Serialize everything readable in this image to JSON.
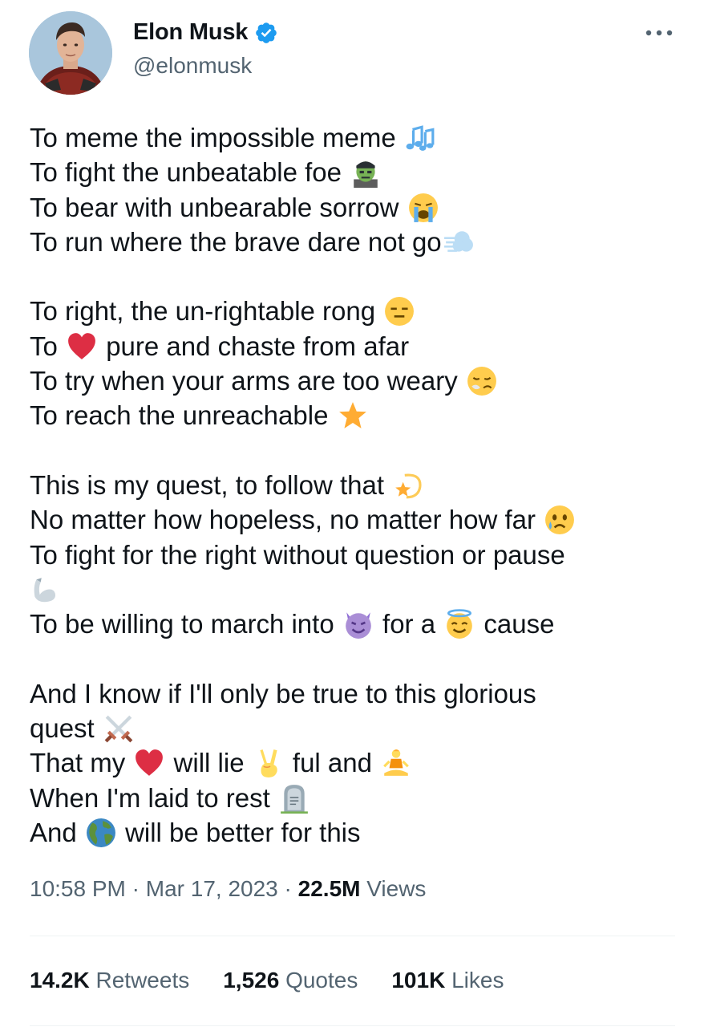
{
  "author": {
    "name": "Elon Musk",
    "handle": "@elonmusk",
    "verified_color": "#1d9bf0"
  },
  "tweet": {
    "lines": [
      {
        "text": "To meme the impossible meme",
        "emoji": "musical-notes-icon"
      },
      {
        "text": "To fight the unbeatable foe",
        "emoji": "zombie-icon"
      },
      {
        "text": "To bear with unbearable sorrow",
        "emoji": "crying-face-icon"
      },
      {
        "text": "To run where the brave dare not go",
        "emoji": "dash-icon"
      },
      {
        "text": "To right, the un-rightable rong",
        "emoji": "expressionless-face-icon"
      },
      {
        "text_before": "To",
        "emoji": "red-heart-icon",
        "text_after": "pure and chaste from afar"
      },
      {
        "text": "To try when your arms are too weary",
        "emoji": "tired-face-icon"
      },
      {
        "text": "To reach the unreachable",
        "emoji": "star-icon"
      },
      {
        "text": "This is my quest, to follow that",
        "emoji": "shooting-star-icon"
      },
      {
        "text": "No matter how hopeless, no matter how far",
        "emoji": "sad-tear-face-icon"
      },
      {
        "text": "To fight for the right without question or pause",
        "emoji": "flexed-biceps-icon"
      },
      {
        "text_before": "To be willing to march into",
        "emoji": "smiling-devil-icon",
        "text_middle": "for a",
        "emoji2": "halo-face-icon",
        "text_after": "cause"
      },
      {
        "text": "And I know if I'll only be true to this glorious"
      },
      {
        "text": "quest",
        "emoji": "crossed-swords-icon"
      },
      {
        "text_before": "That my",
        "emoji": "red-heart-icon",
        "text_middle": "will lie",
        "emoji2": "victory-hand-icon",
        "text_after": "ful and",
        "emoji3": "person-lotus-icon"
      },
      {
        "text": "When I'm laid to rest",
        "emoji": "headstone-icon"
      },
      {
        "text_before": "And",
        "emoji": "globe-icon",
        "text_after": "will be better for this"
      }
    ]
  },
  "meta": {
    "time": "10:58 PM",
    "separator": "·",
    "date": "Mar 17, 2023",
    "views_count": "22.5M",
    "views_label": "Views"
  },
  "stats": {
    "retweets_count": "14.2K",
    "retweets_label": "Retweets",
    "quotes_count": "1,526",
    "quotes_label": "Quotes",
    "likes_count": "101K",
    "likes_label": "Likes"
  }
}
